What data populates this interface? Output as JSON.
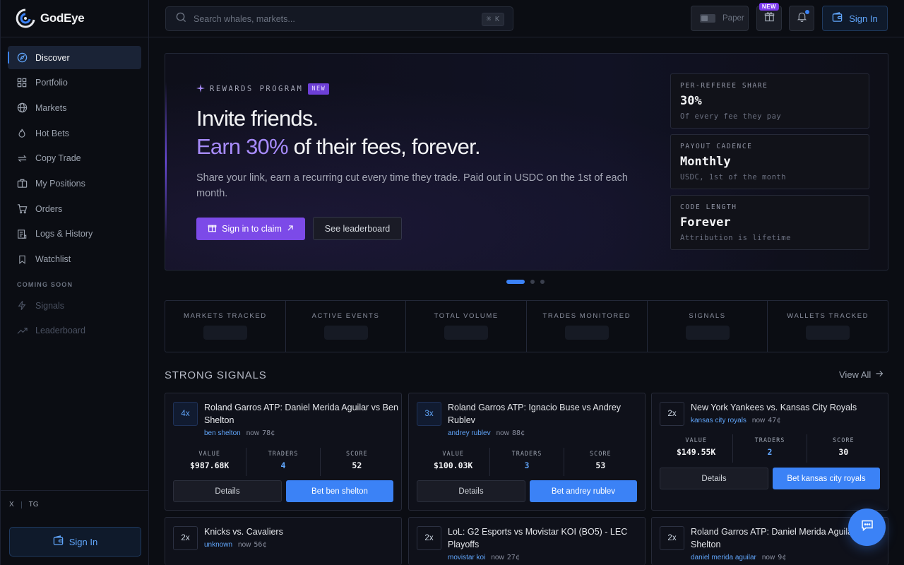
{
  "app": {
    "name": "GodEye"
  },
  "sidebar": {
    "items": [
      {
        "label": "Discover",
        "icon": "compass-icon"
      },
      {
        "label": "Portfolio",
        "icon": "grid-icon"
      },
      {
        "label": "Markets",
        "icon": "globe-icon"
      },
      {
        "label": "Hot Bets",
        "icon": "flame-icon"
      },
      {
        "label": "Copy Trade",
        "icon": "repeat-icon"
      },
      {
        "label": "My Positions",
        "icon": "briefcase-icon"
      },
      {
        "label": "Orders",
        "icon": "cart-icon"
      },
      {
        "label": "Logs & History",
        "icon": "logs-icon"
      },
      {
        "label": "Watchlist",
        "icon": "bookmark-icon"
      }
    ],
    "coming_soon_label": "COMING SOON",
    "coming_soon": [
      {
        "label": "Signals",
        "icon": "bolt-icon"
      },
      {
        "label": "Leaderboard",
        "icon": "trend-icon"
      }
    ],
    "social": {
      "x": "X",
      "tg": "TG"
    },
    "sign_in": "Sign In"
  },
  "topbar": {
    "search_placeholder": "Search whales, markets...",
    "shortcut": "⌘ K",
    "paper_label": "Paper",
    "gift_badge": "NEW",
    "sign_in": "Sign In"
  },
  "hero": {
    "tag": "REWARDS PROGRAM",
    "tag_badge": "NEW",
    "line1": "Invite friends.",
    "line2_accent": "Earn 30%",
    "line2_rest": " of their fees, forever.",
    "description": "Share your link, earn a recurring cut every time they trade. Paid out in USDC on the 1st of each month.",
    "claim_button": "Sign in to claim",
    "leaderboard_button": "See leaderboard",
    "stats": [
      {
        "label": "PER-REFEREE SHARE",
        "value": "30%",
        "sub": "Of every fee they pay"
      },
      {
        "label": "PAYOUT CADENCE",
        "value": "Monthly",
        "sub": "USDC, 1st of the month"
      },
      {
        "label": "CODE LENGTH",
        "value": "Forever",
        "sub": "Attribution is lifetime"
      }
    ]
  },
  "carousel": {
    "total": 3,
    "active": 1
  },
  "metrics": [
    "MARKETS TRACKED",
    "ACTIVE EVENTS",
    "TOTAL VOLUME",
    "TRADES MONITORED",
    "SIGNALS",
    "WALLETS TRACKED"
  ],
  "signals": {
    "title": "STRONG SIGNALS",
    "view_all": "View All",
    "labels": {
      "value": "VALUE",
      "traders": "TRADERS",
      "score": "SCORE",
      "details": "Details"
    },
    "cards": [
      {
        "mult": "4x",
        "title": "Roland Garros ATP: Daniel Merida Aguilar vs Ben Shelton",
        "who": "ben shelton",
        "time": "now",
        "price": "78¢",
        "value": "$987.68K",
        "traders": "4",
        "score": "52",
        "bet": "Bet ben shelton"
      },
      {
        "mult": "3x",
        "title": "Roland Garros ATP: Ignacio Buse vs Andrey Rublev",
        "who": "andrey rublev",
        "time": "now",
        "price": "88¢",
        "value": "$100.03K",
        "traders": "3",
        "score": "53",
        "bet": "Bet andrey rublev"
      },
      {
        "mult": "2x",
        "title": "New York Yankees vs. Kansas City Royals",
        "who": "kansas city royals",
        "time": "now",
        "price": "47¢",
        "value": "$149.55K",
        "traders": "2",
        "score": "30",
        "bet": "Bet kansas city royals"
      },
      {
        "mult": "2x",
        "title": "Knicks vs. Cavaliers",
        "who": "unknown",
        "time": "now",
        "price": "56¢"
      },
      {
        "mult": "2x",
        "title": "LoL: G2 Esports vs Movistar KOI (BO5) - LEC Playoffs",
        "who": "movistar koi",
        "time": "now",
        "price": "27¢"
      },
      {
        "mult": "2x",
        "title": "Roland Garros ATP: Daniel Merida Aguilar vs Ben Shelton",
        "who": "daniel merida aguilar",
        "time": "now",
        "price": "9¢"
      }
    ]
  },
  "colors": {
    "accent": "#3b82f6",
    "purple": "#7c4ae8",
    "background": "#0b0d13"
  }
}
